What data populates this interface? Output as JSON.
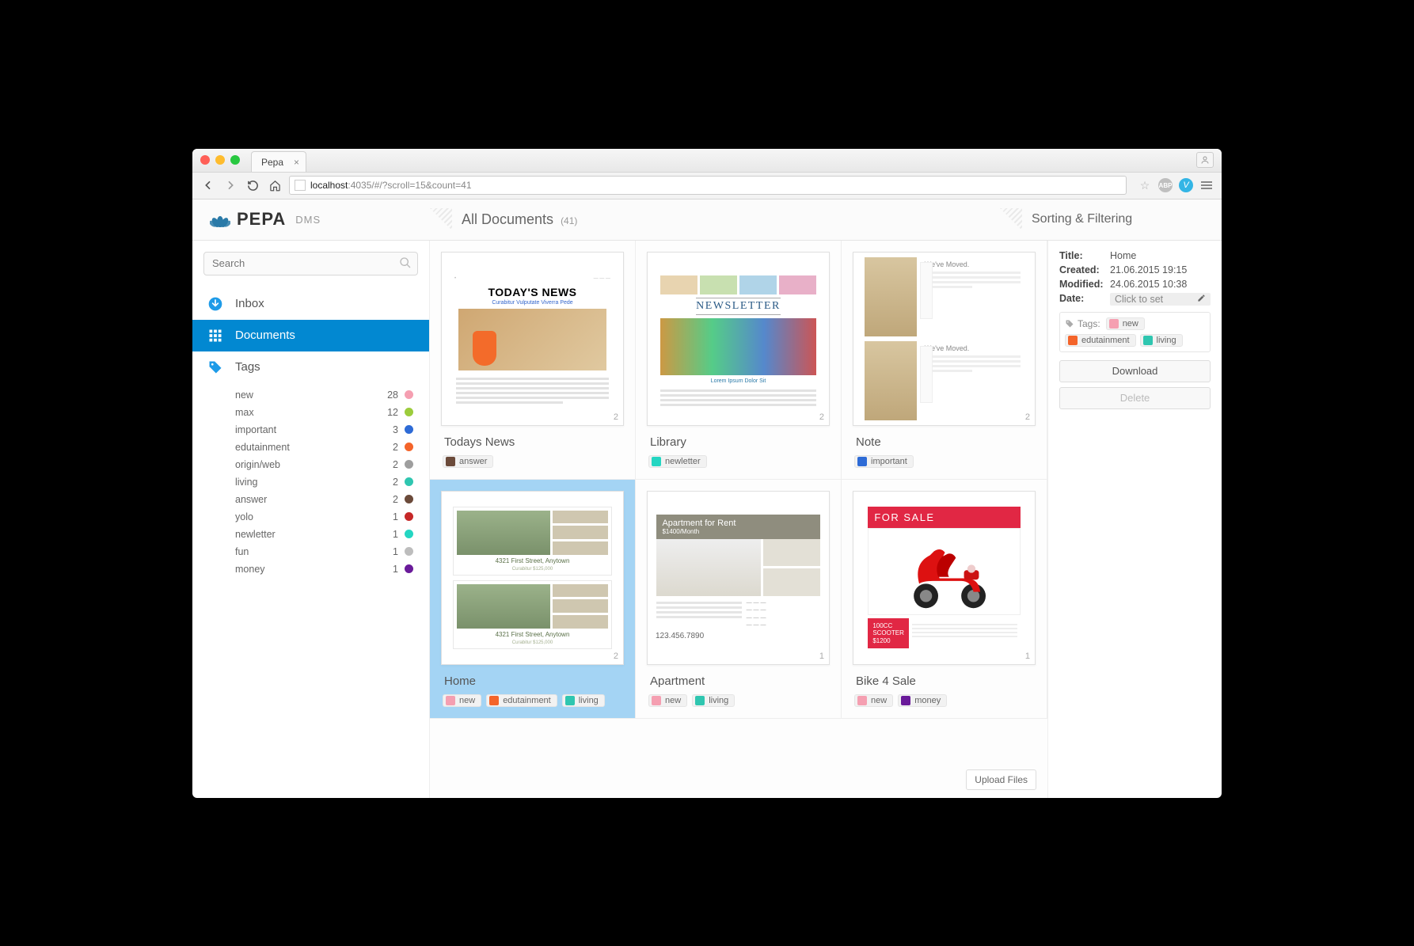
{
  "browser": {
    "tab_title": "Pepa",
    "url_prefix": "localhost",
    "url_rest": ":4035/#/?scroll=15&count=41"
  },
  "logo": {
    "name": "PEPA",
    "sub": "DMS"
  },
  "header": {
    "title": "All Documents",
    "count": "(41)",
    "right": "Sorting & Filtering"
  },
  "search": {
    "placeholder": "Search"
  },
  "nav": {
    "inbox": "Inbox",
    "documents": "Documents",
    "tags": "Tags"
  },
  "tag_colors": {
    "new": "#f59fb1",
    "max": "#9ccc3c",
    "important": "#2e6bd6",
    "edutainment": "#f4642a",
    "origin/web": "#9e9e9e",
    "living": "#2fc6b0",
    "answer": "#6b4a3a",
    "yolo": "#c62828",
    "newletter": "#24d6c2",
    "fun": "#bdbdbd",
    "money": "#6a1b9a"
  },
  "tags": [
    {
      "name": "new",
      "count": "28",
      "color": "#f59fb1"
    },
    {
      "name": "max",
      "count": "12",
      "color": "#9ccc3c"
    },
    {
      "name": "important",
      "count": "3",
      "color": "#2e6bd6"
    },
    {
      "name": "edutainment",
      "count": "2",
      "color": "#f4642a"
    },
    {
      "name": "origin/web",
      "count": "2",
      "color": "#9e9e9e"
    },
    {
      "name": "living",
      "count": "2",
      "color": "#2fc6b0"
    },
    {
      "name": "answer",
      "count": "2",
      "color": "#6b4a3a"
    },
    {
      "name": "yolo",
      "count": "1",
      "color": "#c62828"
    },
    {
      "name": "newletter",
      "count": "1",
      "color": "#24d6c2"
    },
    {
      "name": "fun",
      "count": "1",
      "color": "#bdbdbd"
    },
    {
      "name": "money",
      "count": "1",
      "color": "#6a1b9a"
    }
  ],
  "thumbs": {
    "news_headline": "TODAY'S NEWS",
    "news_sub": "Curabitur Vulputate Viverra Pede",
    "newsletter_label": "NEWSLETTER",
    "newsletter_caption": "Lorem Ipsum Dolor Sit",
    "note_label": "We've Moved.",
    "home_addr": "4321 First Street, Anytown",
    "home_sub": "Curabitur $125,000",
    "apt_title": "Apartment for Rent",
    "apt_price": "$1400/Month",
    "apt_phone": "123.456.7890",
    "bike_banner": "FOR SALE",
    "bike_price_l1": "100CC",
    "bike_price_l2": "SCOOTER",
    "bike_price_l3": "$1200"
  },
  "docs": [
    {
      "title": "Todays News",
      "pages": "2",
      "tags": [
        {
          "n": "answer",
          "c": "#6b4a3a"
        }
      ]
    },
    {
      "title": "Library",
      "pages": "2",
      "tags": [
        {
          "n": "newletter",
          "c": "#24d6c2"
        }
      ]
    },
    {
      "title": "Note",
      "pages": "2",
      "tags": [
        {
          "n": "important",
          "c": "#2e6bd6"
        }
      ]
    },
    {
      "title": "Home",
      "pages": "2",
      "selected": true,
      "tags": [
        {
          "n": "new",
          "c": "#f59fb1"
        },
        {
          "n": "edutainment",
          "c": "#f4642a"
        },
        {
          "n": "living",
          "c": "#2fc6b0"
        }
      ]
    },
    {
      "title": "Apartment",
      "pages": "1",
      "tags": [
        {
          "n": "new",
          "c": "#f59fb1"
        },
        {
          "n": "living",
          "c": "#2fc6b0"
        }
      ]
    },
    {
      "title": "Bike 4 Sale",
      "pages": "1",
      "tags": [
        {
          "n": "new",
          "c": "#f59fb1"
        },
        {
          "n": "money",
          "c": "#6a1b9a"
        }
      ]
    }
  ],
  "details": {
    "title_k": "Title:",
    "title_v": "Home",
    "created_k": "Created:",
    "created_v": "21.06.2015 19:15",
    "modified_k": "Modified:",
    "modified_v": "24.06.2015 10:38",
    "date_k": "Date:",
    "date_placeholder": "Click to set",
    "tags_label": "Tags:",
    "tags": [
      {
        "n": "new",
        "c": "#f59fb1"
      },
      {
        "n": "edutainment",
        "c": "#f4642a"
      },
      {
        "n": "living",
        "c": "#2fc6b0"
      }
    ],
    "download": "Download",
    "delete": "Delete"
  },
  "upload_label": "Upload Files"
}
